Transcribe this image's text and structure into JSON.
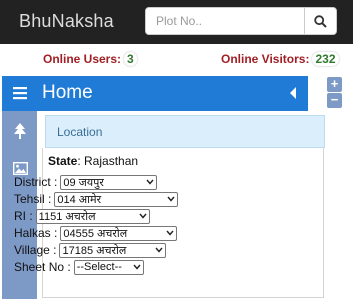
{
  "app": {
    "title": "BhuNaksha"
  },
  "search": {
    "placeholder": "Plot No..",
    "value": ""
  },
  "stats": {
    "online_users_label": "Online Users:",
    "online_users_count": "3",
    "online_visitors_label": "Online Visitors:",
    "online_visitors_count": "232"
  },
  "home": {
    "title": "Home"
  },
  "zoom": {
    "in_label": "+",
    "out_label": "−"
  },
  "location": {
    "tab_label": "Location"
  },
  "state": {
    "label": "State",
    "value": ": Rajasthan"
  },
  "fields": [
    {
      "label": "District :",
      "value": "09 जयपुर"
    },
    {
      "label": "Tehsil :",
      "value": "014 आमेर"
    },
    {
      "label": "RI :",
      "value": "1151 अचरोल"
    },
    {
      "label": "Halkas :",
      "value": "04555 अचरोल"
    },
    {
      "label": "Village :",
      "value": "17185 अचरोल"
    },
    {
      "label": "Sheet No :",
      "value": "--Select--"
    }
  ],
  "icons": {
    "search": "search-icon",
    "menu": "hamburger-menu-icon",
    "collapse": "caret-left-icon",
    "tree": "tree-icon",
    "image": "image-icon"
  },
  "colors": {
    "topbar": "#222222",
    "header_blue": "#1f7bd6",
    "sidebar": "#7d9ac7",
    "stat_red": "#a11f24",
    "count_green": "#2f7a2f"
  }
}
